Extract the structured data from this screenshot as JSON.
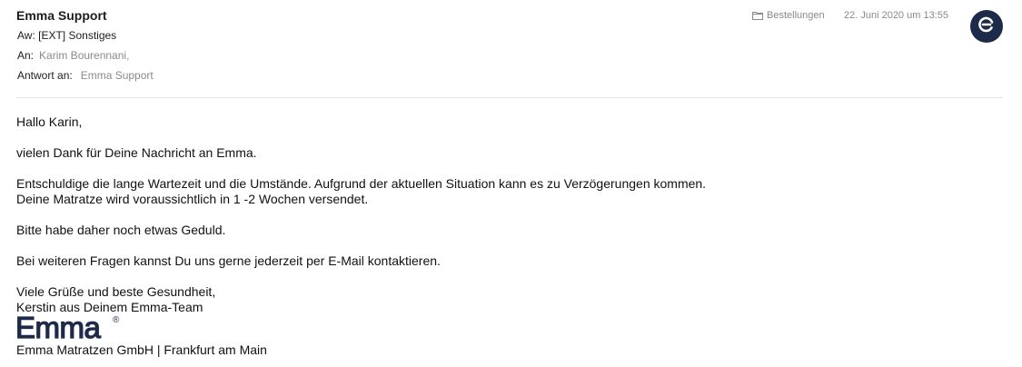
{
  "header": {
    "sender": "Emma Support",
    "subject": "Aw: [EXT] Sonstiges",
    "to_label": "An:",
    "to_value": "Karim Bourennani,",
    "reply_label": "Antwort an:",
    "reply_value": "Emma Support",
    "folder": "Bestellungen",
    "folder_icon": "folder-icon",
    "date": "22. Juni 2020 um 13:55",
    "avatar_icon": "emma-logo-icon",
    "avatar_color": "#1e2a4a"
  },
  "body": {
    "greeting": "Hallo Karin,",
    "thanks": "vielen Dank für Deine Nachricht an Emma.",
    "apology_line1": "Entschuldige die lange Wartezeit und die Umstände. Aufgrund der aktuellen Situation kann es zu Verzögerungen kommen.",
    "apology_line2": "Deine Matratze wird voraussichtlich in 1 -2 Wochen versendet.",
    "patience": "Bitte habe daher noch etwas Geduld.",
    "contact": "Bei weiteren Fragen kannst Du uns gerne jederzeit per E-Mail kontaktieren.",
    "closing_line1": "Viele Grüße und beste Gesundheit,",
    "closing_line2": "Kerstin aus Deinem Emma-Team"
  },
  "signature": {
    "logo_text": "Emma",
    "logo_mark": "®",
    "company": "Emma Matratzen GmbH | Frankfurt am Main"
  }
}
